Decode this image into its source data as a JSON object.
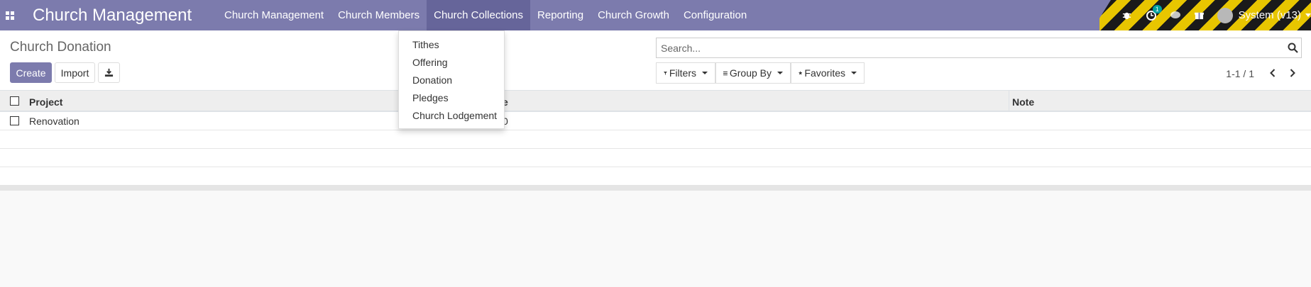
{
  "navbar": {
    "brand": "Church Management",
    "menu": [
      {
        "label": "Church Management"
      },
      {
        "label": "Church Members"
      },
      {
        "label": "Church Collections"
      },
      {
        "label": "Reporting"
      },
      {
        "label": "Church Growth"
      },
      {
        "label": "Configuration"
      }
    ],
    "active_menu": "Church Collections",
    "systray": {
      "activity_count": "1",
      "user_name": "System (v13)"
    },
    "colors": {
      "navbar": "#7c7bad",
      "active": "#66659a",
      "badge": "#00a09d"
    }
  },
  "dropdown": {
    "items": [
      "Tithes",
      "Offering",
      "Donation",
      "Pledges",
      "Church Lodgement"
    ]
  },
  "control_panel": {
    "title": "Church Donation",
    "create_label": "Create",
    "import_label": "Import",
    "search_placeholder": "Search...",
    "filters_label": "Filters",
    "groupby_label": "Group By",
    "favorites_label": "Favorites",
    "pager": "1-1 / 1"
  },
  "table": {
    "columns": [
      "Project",
      "e",
      "Note"
    ],
    "rows": [
      {
        "project": "Renovation",
        "value": "0",
        "note": ""
      }
    ]
  },
  "icons": {
    "apps": "apps-grid-icon",
    "bug": "bug-icon",
    "activity": "clock-icon",
    "chat": "chat-icon",
    "gift": "gift-icon",
    "search": "search-icon",
    "download": "download-icon",
    "filter": "filter-icon",
    "groupby": "list-icon",
    "favorites": "star-icon"
  }
}
